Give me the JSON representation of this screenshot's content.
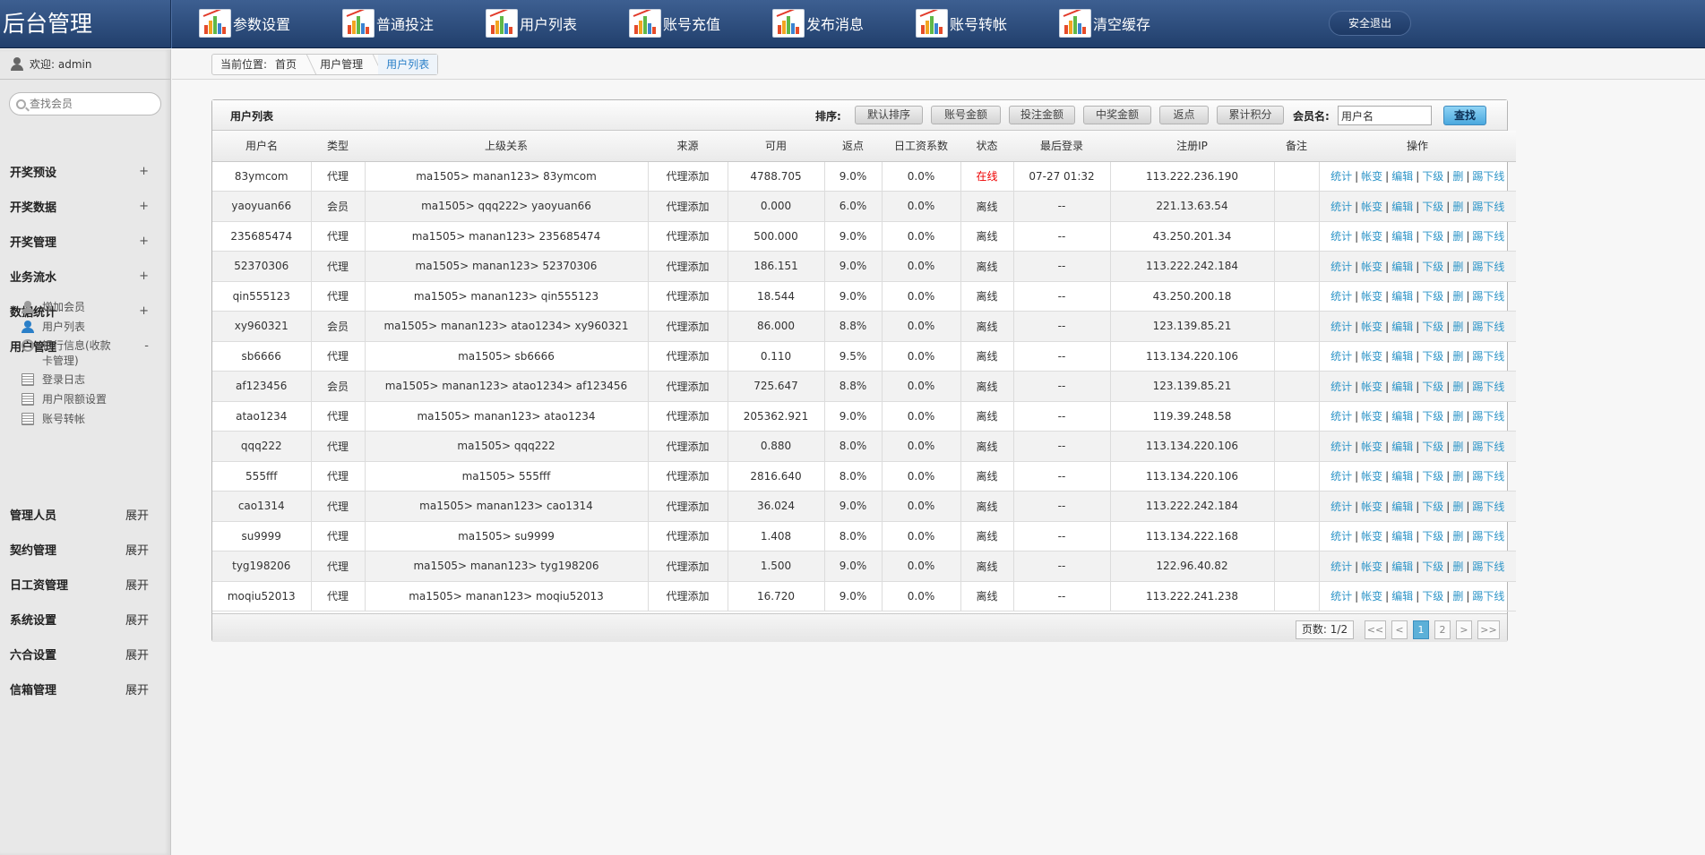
{
  "header": {
    "logo": "后台管理",
    "nav": [
      {
        "label": "参数设置",
        "icon": "chart-icon"
      },
      {
        "label": "普通投注",
        "icon": "chart-icon"
      },
      {
        "label": "用户列表",
        "icon": "chart-icon"
      },
      {
        "label": "账号充值",
        "icon": "chart-icon"
      },
      {
        "label": "发布消息",
        "icon": "chart-icon"
      },
      {
        "label": "账号转帐",
        "icon": "chart-icon"
      },
      {
        "label": "清空缓存",
        "icon": "chart-icon"
      }
    ],
    "logout": "安全退出"
  },
  "sidebar": {
    "welcome": "欢迎: admin",
    "search_placeholder": "查找会员",
    "menus": [
      {
        "label": "开奖预设",
        "toggle": "+"
      },
      {
        "label": "开奖数据",
        "toggle": "+"
      },
      {
        "label": "开奖管理",
        "toggle": "+"
      },
      {
        "label": "业务流水",
        "toggle": "+"
      },
      {
        "label": "数据统计",
        "toggle": "+"
      },
      {
        "label": "用户管理",
        "toggle": "-"
      },
      {
        "label": "管理人员",
        "toggle": "展开"
      },
      {
        "label": "契约管理",
        "toggle": "展开"
      },
      {
        "label": "日工资管理",
        "toggle": "展开"
      },
      {
        "label": "系统设置",
        "toggle": "展开"
      },
      {
        "label": "六合设置",
        "toggle": "展开"
      },
      {
        "label": "信箱管理",
        "toggle": "展开"
      }
    ],
    "sub_items": [
      {
        "label": "增加会员",
        "icon": "user-add-icon"
      },
      {
        "label": "用户列表",
        "icon": "user-icon"
      },
      {
        "label": "银行信息(收款卡管理)",
        "line1": "银行信息(收款",
        "line2": "卡管理)",
        "icon": "bank-icon"
      },
      {
        "label": "登录日志",
        "icon": "document-icon"
      },
      {
        "label": "用户限额设置",
        "icon": "document-icon"
      },
      {
        "label": "账号转帐",
        "icon": "document-icon"
      }
    ]
  },
  "breadcrumb": {
    "label": "当前位置:",
    "items": [
      "首页",
      "用户管理",
      "用户列表"
    ]
  },
  "panel": {
    "title": "用户列表",
    "sort_label": "排序:",
    "sort_buttons": [
      "默认排序",
      "账号金额",
      "投注金额",
      "中奖金额",
      "返点",
      "累计积分"
    ],
    "member_label": "会员名:",
    "member_value": "用户名",
    "find_button": "查找"
  },
  "table": {
    "columns": [
      "用户名",
      "类型",
      "上级关系",
      "来源",
      "可用",
      "返点",
      "日工资系数",
      "状态",
      "最后登录",
      "注册IP",
      "备注",
      "操作"
    ],
    "ops": [
      "统计",
      "帐变",
      "编辑",
      "下级",
      "删",
      "踢下线"
    ],
    "rows": [
      [
        "83ymcom",
        "代理",
        "ma1505> manan123> 83ymcom",
        "代理添加",
        "4788.705",
        "9.0%",
        "0.0%",
        "在线",
        "07-27 01:32",
        "113.222.236.190",
        ""
      ],
      [
        "yaoyuan66",
        "会员",
        "ma1505> qqq222> yaoyuan66",
        "代理添加",
        "0.000",
        "6.0%",
        "0.0%",
        "离线",
        "--",
        "221.13.63.54",
        ""
      ],
      [
        "235685474",
        "代理",
        "ma1505> manan123> 235685474",
        "代理添加",
        "500.000",
        "9.0%",
        "0.0%",
        "离线",
        "--",
        "43.250.201.34",
        ""
      ],
      [
        "52370306",
        "代理",
        "ma1505> manan123> 52370306",
        "代理添加",
        "186.151",
        "9.0%",
        "0.0%",
        "离线",
        "--",
        "113.222.242.184",
        ""
      ],
      [
        "qin555123",
        "代理",
        "ma1505> manan123> qin555123",
        "代理添加",
        "18.544",
        "9.0%",
        "0.0%",
        "离线",
        "--",
        "43.250.200.18",
        ""
      ],
      [
        "xy960321",
        "会员",
        "ma1505> manan123> atao1234> xy960321",
        "代理添加",
        "86.000",
        "8.8%",
        "0.0%",
        "离线",
        "--",
        "123.139.85.21",
        ""
      ],
      [
        "sb6666",
        "代理",
        "ma1505> sb6666",
        "代理添加",
        "0.110",
        "9.5%",
        "0.0%",
        "离线",
        "--",
        "113.134.220.106",
        ""
      ],
      [
        "af123456",
        "会员",
        "ma1505> manan123> atao1234> af123456",
        "代理添加",
        "725.647",
        "8.8%",
        "0.0%",
        "离线",
        "--",
        "123.139.85.21",
        ""
      ],
      [
        "atao1234",
        "代理",
        "ma1505> manan123> atao1234",
        "代理添加",
        "205362.921",
        "9.0%",
        "0.0%",
        "离线",
        "--",
        "119.39.248.58",
        ""
      ],
      [
        "qqq222",
        "代理",
        "ma1505> qqq222",
        "代理添加",
        "0.880",
        "8.0%",
        "0.0%",
        "离线",
        "--",
        "113.134.220.106",
        ""
      ],
      [
        "555fff",
        "代理",
        "ma1505> 555fff",
        "代理添加",
        "2816.640",
        "8.0%",
        "0.0%",
        "离线",
        "--",
        "113.134.220.106",
        ""
      ],
      [
        "cao1314",
        "代理",
        "ma1505> manan123> cao1314",
        "代理添加",
        "36.024",
        "9.0%",
        "0.0%",
        "离线",
        "--",
        "113.222.242.184",
        ""
      ],
      [
        "su9999",
        "代理",
        "ma1505> su9999",
        "代理添加",
        "1.408",
        "8.0%",
        "0.0%",
        "离线",
        "--",
        "113.134.222.168",
        ""
      ],
      [
        "tyg198206",
        "代理",
        "ma1505> manan123> tyg198206",
        "代理添加",
        "1.500",
        "9.0%",
        "0.0%",
        "离线",
        "--",
        "122.96.40.82",
        ""
      ],
      [
        "moqiu52013",
        "代理",
        "ma1505> manan123> moqiu52013",
        "代理添加",
        "16.720",
        "9.0%",
        "0.0%",
        "离线",
        "--",
        "113.222.241.238",
        ""
      ]
    ]
  },
  "pager": {
    "info": "页数: 1/2",
    "first": "<<",
    "prev": "<",
    "pages": [
      "1",
      "2"
    ],
    "next": ">",
    "last": ">>"
  },
  "colors": {
    "header_bg": "#2c4d7e",
    "accent": "#2e95c8",
    "online": "#e00000"
  }
}
